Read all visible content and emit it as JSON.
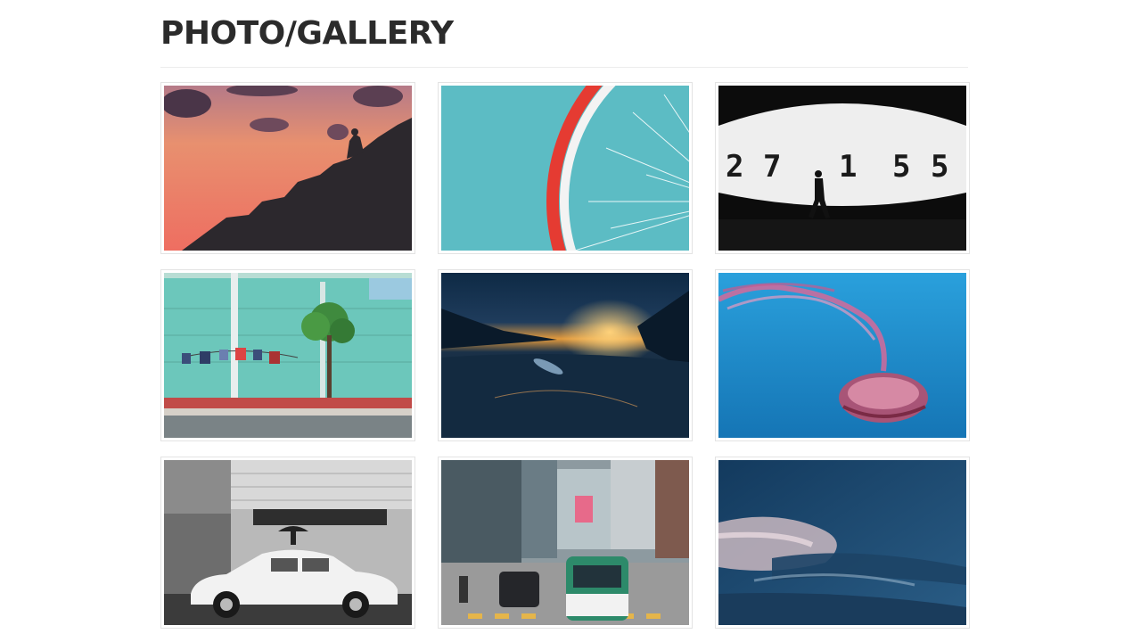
{
  "header": {
    "title": "PHOTO/GALLERY"
  },
  "gallery": {
    "items": [
      {
        "subject": "sunset-rooftop-silhouette",
        "dominant_color": "#e8776a"
      },
      {
        "subject": "bicycle-wheel-teal-wall",
        "dominant_color": "#5cbcc6"
      },
      {
        "subject": "man-walking-digital-clock",
        "dominant_color": "#111111"
      },
      {
        "subject": "teal-building-laundry-tree",
        "dominant_color": "#6cc3b6"
      },
      {
        "subject": "sunset-boats-bay",
        "dominant_color": "#12324a"
      },
      {
        "subject": "jellyfish-blue-water",
        "dominant_color": "#1a8fd0"
      },
      {
        "subject": "vintage-car-black-white",
        "dominant_color": "#9a9a9a"
      },
      {
        "subject": "city-street-minibus",
        "dominant_color": "#6a7478"
      },
      {
        "subject": "cloudy-sky-dusk",
        "dominant_color": "#1f4f78"
      }
    ]
  },
  "digits": [
    "2",
    "7",
    "1",
    "5",
    "5"
  ]
}
